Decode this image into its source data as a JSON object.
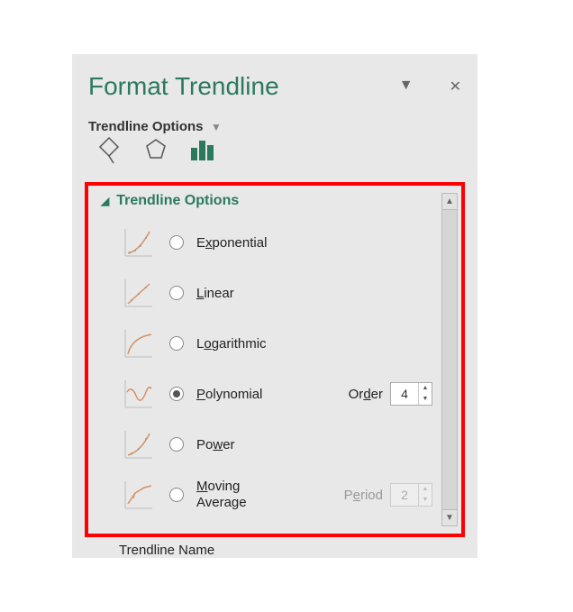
{
  "panel": {
    "title": "Format Trendline",
    "subtitle": "Trendline Options",
    "close_label": "✕",
    "dropdown_label": "▼"
  },
  "section": {
    "header": "Trendline Options",
    "caret": "◢"
  },
  "options": [
    {
      "id": "exponential",
      "label_pre": "E",
      "label_u": "x",
      "label_post": "ponential",
      "selected": false
    },
    {
      "id": "linear",
      "label_pre": "",
      "label_u": "L",
      "label_post": "inear",
      "selected": false
    },
    {
      "id": "logarithmic",
      "label_pre": "L",
      "label_u": "o",
      "label_post": "garithmic",
      "selected": false
    },
    {
      "id": "polynomial",
      "label_pre": "",
      "label_u": "P",
      "label_post": "olynomial",
      "selected": true
    },
    {
      "id": "power",
      "label_pre": "Po",
      "label_u": "w",
      "label_post": "er",
      "selected": false
    },
    {
      "id": "moving-average",
      "label_pre": "",
      "label_u": "M",
      "label_post": "oving Average",
      "selected": false
    }
  ],
  "params": {
    "order_label_pre": "Or",
    "order_label_u": "d",
    "order_label_post": "er",
    "order_value": "4",
    "period_label_pre": "P",
    "period_label_u": "e",
    "period_label_post": "riod",
    "period_value": "2"
  },
  "footer": {
    "trendline_name_label": "Trendline Name"
  }
}
